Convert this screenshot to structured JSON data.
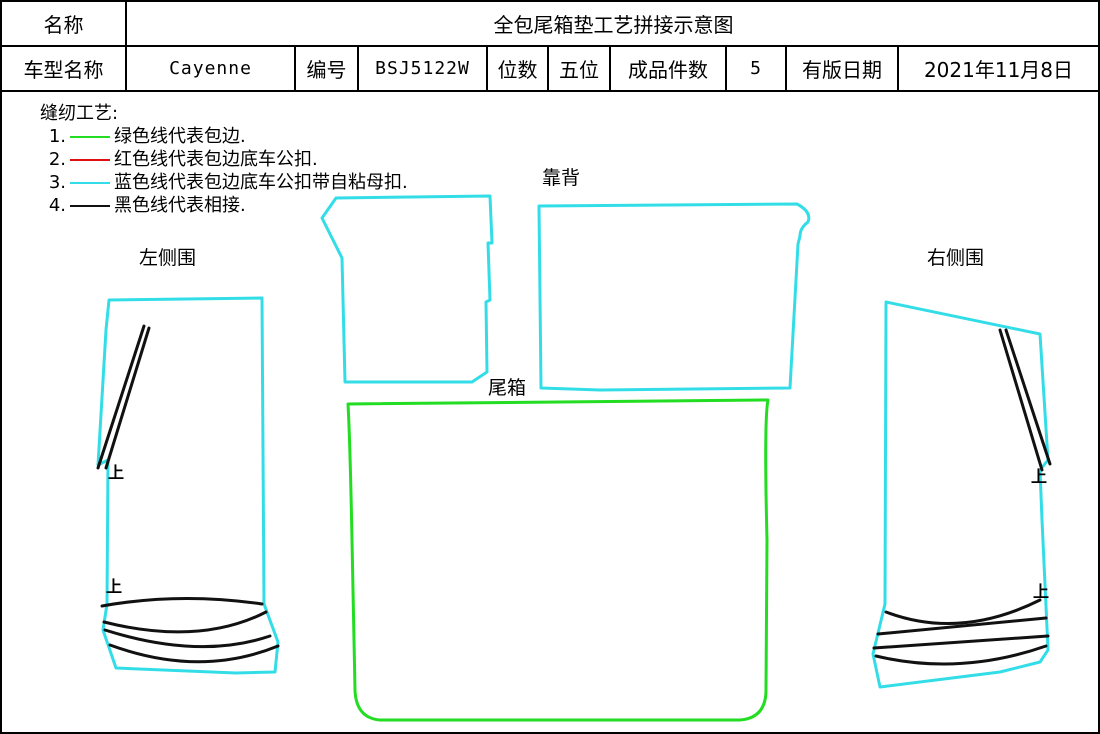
{
  "header": {
    "name_label": "名称",
    "doc_title": "全包尾箱垫工艺拼接示意图",
    "model_label": "车型名称",
    "model_value": "Cayenne",
    "code_label": "编号",
    "code_value": "BSJ5122W",
    "seats_label": "位数",
    "seats_value": "五位",
    "count_label": "成品件数",
    "count_value": "5",
    "date_label": "有版日期",
    "date_value": "2021年11月8日"
  },
  "legend": {
    "title": "缝纫工艺:",
    "items": [
      {
        "num": "1.",
        "color": "#22dd22",
        "text": "绿色线代表包边."
      },
      {
        "num": "2.",
        "color": "#e01010",
        "text": "红色线代表包边底车公扣."
      },
      {
        "num": "3.",
        "color": "#33dde8",
        "text": "蓝色线代表包边底车公扣带自粘母扣."
      },
      {
        "num": "4.",
        "color": "#111111",
        "text": "黑色线代表相接."
      }
    ]
  },
  "parts": {
    "left_side": "左侧围",
    "right_side": "右侧围",
    "backrest": "靠背",
    "trunk": "尾箱"
  },
  "marks": {
    "up": "上"
  },
  "colors": {
    "green": "#22dd22",
    "cyan": "#33dde8",
    "black": "#111111"
  }
}
